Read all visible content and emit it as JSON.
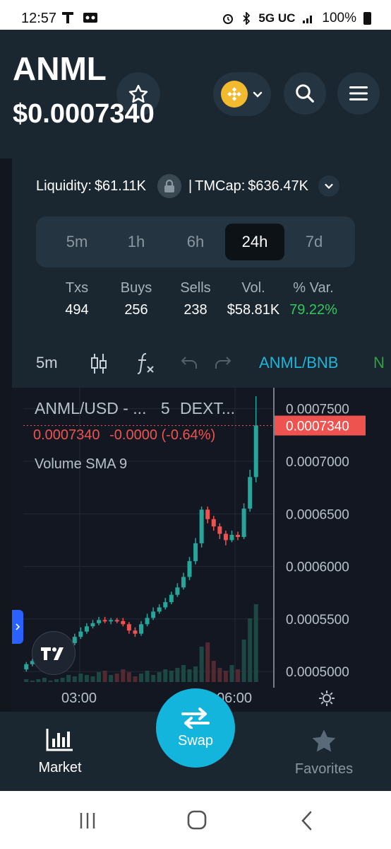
{
  "status_bar": {
    "time": "12:57",
    "network": "5G UC",
    "battery": "100%"
  },
  "header": {
    "ticker": "ANML",
    "price": "$0.0007340"
  },
  "pool": {
    "liquidity_label": "Liquidity:",
    "liquidity": "$61.11K",
    "separator": "|",
    "tmcap_label": "TMCap:",
    "tmcap": "$636.47K"
  },
  "timeframes": [
    "5m",
    "1h",
    "6h",
    "24h",
    "7d"
  ],
  "active_timeframe": "24h",
  "stats": {
    "headers": [
      "Txs",
      "Buys",
      "Sells",
      "Vol.",
      "% Var."
    ],
    "values": [
      "494",
      "256",
      "238",
      "$58.81K",
      "79.22%"
    ]
  },
  "chart_toolbar": {
    "interval": "5m",
    "pair": "ANML/BNB"
  },
  "chart": {
    "legend_symbol": "ANML/USD - ...",
    "legend_interval": "5",
    "legend_source": "DEXT...",
    "legend_ohlc_price": "0.0007340",
    "legend_change": "-0.0000 (-0.64%)",
    "indicator": "Volume SMA 9",
    "y_ticks": [
      "0.0007500",
      "0.0007000",
      "0.0006500",
      "0.0006000",
      "0.0005500",
      "0.0005000"
    ],
    "last_price_label": "0.0007340",
    "x_ticks": [
      "03:00",
      "06:00"
    ],
    "colors": {
      "up": "#26a69a",
      "down": "#ef5350",
      "accent": "#13b5dc"
    }
  },
  "chart_data": {
    "type": "candlestick",
    "title": "ANML/USD - ... 5 DEXT...",
    "ylim": [
      0.00049,
      0.00077
    ],
    "x_ticks": [
      "03:00",
      "06:00"
    ],
    "candles": [
      [
        0.000502,
        0.000507,
        0.0005,
        0.000509
      ],
      [
        0.000507,
        0.00051,
        0.000505,
        0.000512
      ],
      [
        0.00051,
        0.000512,
        0.000508,
        0.000515
      ],
      [
        0.000512,
        0.000515,
        0.00051,
        0.000518
      ],
      [
        0.000515,
        0.000517,
        0.000513,
        0.00052
      ],
      [
        0.000517,
        0.00052,
        0.000515,
        0.000523
      ],
      [
        0.00052,
        0.000522,
        0.000518,
        0.000526
      ],
      [
        0.000522,
        0.000527,
        0.00052,
        0.00053
      ],
      [
        0.000527,
        0.000533,
        0.000525,
        0.000536
      ],
      [
        0.000533,
        0.000538,
        0.000531,
        0.000542
      ],
      [
        0.000538,
        0.000543,
        0.000536,
        0.000546
      ],
      [
        0.000543,
        0.000546,
        0.000541,
        0.000549
      ],
      [
        0.000546,
        0.000549,
        0.000544,
        0.000552
      ],
      [
        0.000549,
        0.000548,
        0.000546,
        0.000552
      ],
      [
        0.000548,
        0.000549,
        0.000545,
        0.000551
      ],
      [
        0.000549,
        0.000548,
        0.000546,
        0.000551
      ],
      [
        0.000548,
        0.000545,
        0.000543,
        0.000551
      ],
      [
        0.000545,
        0.000539,
        0.000536,
        0.000547
      ],
      [
        0.000539,
        0.000536,
        0.000533,
        0.000542
      ],
      [
        0.000536,
        0.000545,
        0.000534,
        0.000548
      ],
      [
        0.000545,
        0.000551,
        0.000543,
        0.000555
      ],
      [
        0.000551,
        0.000557,
        0.000549,
        0.000561
      ],
      [
        0.000557,
        0.000561,
        0.000555,
        0.000564
      ],
      [
        0.000561,
        0.000566,
        0.000559,
        0.00057
      ],
      [
        0.000566,
        0.000573,
        0.000564,
        0.000576
      ],
      [
        0.000573,
        0.00058,
        0.000571,
        0.000584
      ],
      [
        0.00058,
        0.00059,
        0.000578,
        0.000594
      ],
      [
        0.00059,
        0.000605,
        0.000587,
        0.000609
      ],
      [
        0.000605,
        0.000622,
        0.000602,
        0.000627
      ],
      [
        0.000622,
        0.000654,
        0.000618,
        0.000657
      ],
      [
        0.000654,
        0.000645,
        0.000641,
        0.000657
      ],
      [
        0.000645,
        0.000638,
        0.000634,
        0.000648
      ],
      [
        0.000638,
        0.000631,
        0.000626,
        0.000641
      ],
      [
        0.000631,
        0.000625,
        0.00062,
        0.000634
      ],
      [
        0.000625,
        0.00063,
        0.000623,
        0.000634
      ],
      [
        0.00063,
        0.000628,
        0.000625,
        0.000633
      ],
      [
        0.000628,
        0.000655,
        0.000626,
        0.00066
      ],
      [
        0.000655,
        0.000685,
        0.000652,
        0.000692
      ],
      [
        0.000685,
        0.000734,
        0.00068,
        0.000762
      ]
    ],
    "volume": [
      2,
      1,
      2,
      3,
      1,
      2,
      3,
      5,
      4,
      6,
      5,
      4,
      7,
      8,
      5,
      6,
      9,
      7,
      4,
      6,
      8,
      5,
      7,
      9,
      8,
      10,
      12,
      9,
      11,
      25,
      28,
      15,
      10,
      8,
      12,
      9,
      30,
      45,
      55
    ]
  },
  "bottom_nav": {
    "market": "Market",
    "swap": "Swap",
    "favorites": "Favorites"
  }
}
